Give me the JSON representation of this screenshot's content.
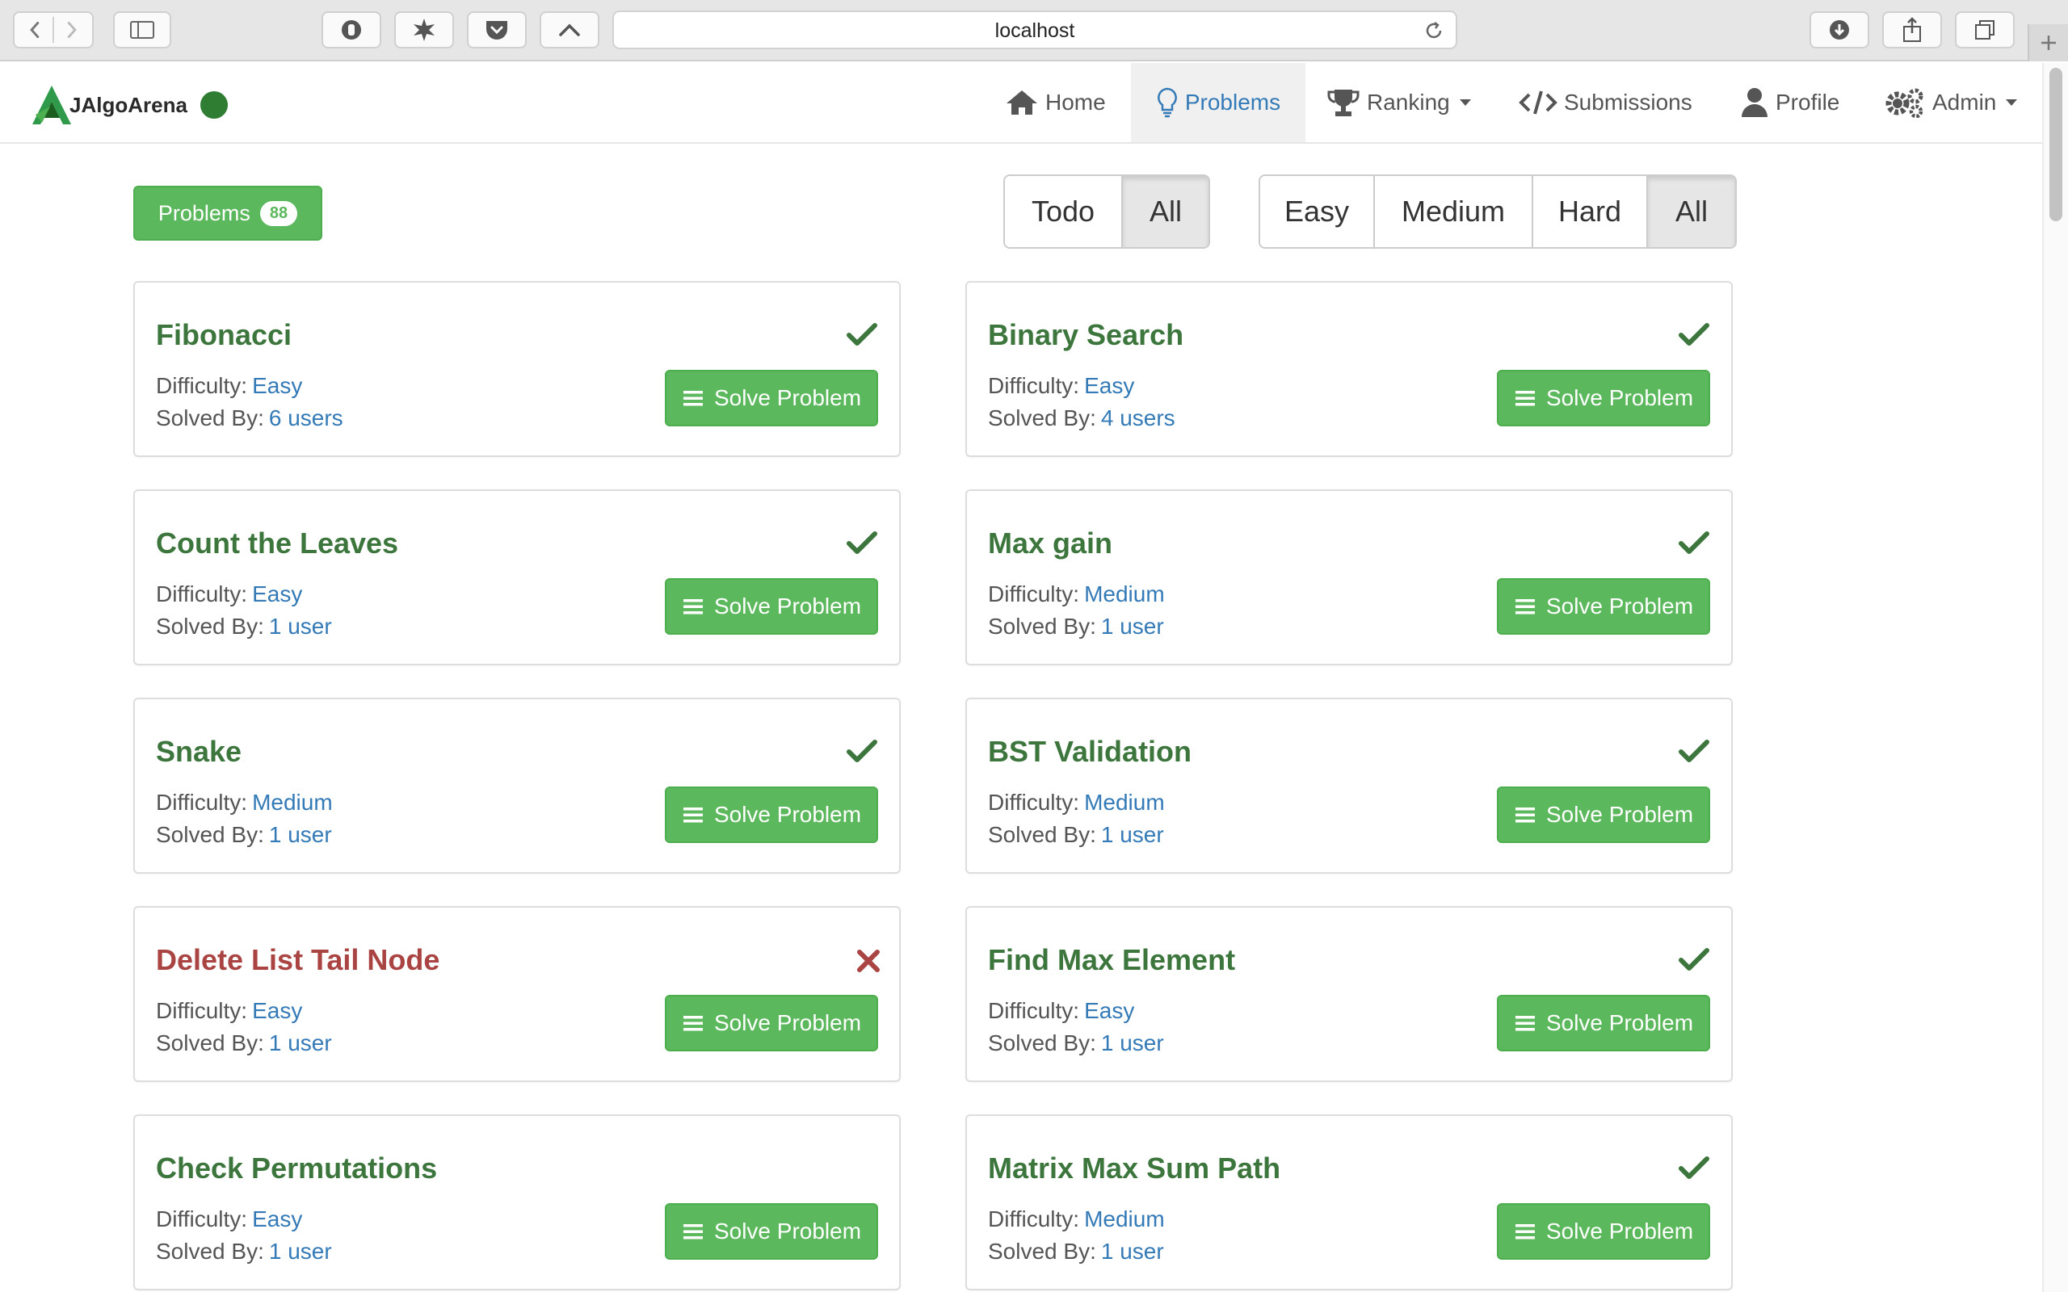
{
  "browser": {
    "url": "localhost"
  },
  "navbar": {
    "brand": "JAlgoArena",
    "items": [
      {
        "label": "Home",
        "icon": "home-icon"
      },
      {
        "label": "Problems",
        "icon": "lightbulb-icon",
        "active": true
      },
      {
        "label": "Ranking",
        "icon": "trophy-icon",
        "dropdown": true
      },
      {
        "label": "Submissions",
        "icon": "code-icon"
      },
      {
        "label": "Profile",
        "icon": "user-icon"
      },
      {
        "label": "Admin",
        "icon": "gears-icon",
        "dropdown": true
      }
    ]
  },
  "toolbar": {
    "problems_label": "Problems",
    "problems_count": "88",
    "status_filter": [
      {
        "label": "Todo"
      },
      {
        "label": "All",
        "active": true
      }
    ],
    "difficulty_filter": [
      {
        "label": "Easy"
      },
      {
        "label": "Medium"
      },
      {
        "label": "Hard"
      },
      {
        "label": "All",
        "active": true
      }
    ]
  },
  "labels": {
    "difficulty": "Difficulty:",
    "solved_by": "Solved By:",
    "solve_button": "Solve Problem"
  },
  "problems": [
    {
      "title": "Fibonacci",
      "difficulty": "Easy",
      "solved_by": "6 users",
      "status": "solved"
    },
    {
      "title": "Binary Search",
      "difficulty": "Easy",
      "solved_by": "4 users",
      "status": "solved"
    },
    {
      "title": "Count the Leaves",
      "difficulty": "Easy",
      "solved_by": "1 user",
      "status": "solved"
    },
    {
      "title": "Max gain",
      "difficulty": "Medium",
      "solved_by": "1 user",
      "status": "solved"
    },
    {
      "title": "Snake",
      "difficulty": "Medium",
      "solved_by": "1 user",
      "status": "solved"
    },
    {
      "title": "BST Validation",
      "difficulty": "Medium",
      "solved_by": "1 user",
      "status": "solved"
    },
    {
      "title": "Delete List Tail Node",
      "difficulty": "Easy",
      "solved_by": "1 user",
      "status": "failed"
    },
    {
      "title": "Find Max Element",
      "difficulty": "Easy",
      "solved_by": "1 user",
      "status": "solved"
    },
    {
      "title": "Check Permutations",
      "difficulty": "Easy",
      "solved_by": "1 user",
      "status": "none"
    },
    {
      "title": "Matrix Max Sum Path",
      "difficulty": "Medium",
      "solved_by": "1 user",
      "status": "solved"
    }
  ],
  "colors": {
    "success": "#5cb85c",
    "solved_title": "#3c763d",
    "failed_title": "#a94442",
    "link": "#337ab7"
  }
}
